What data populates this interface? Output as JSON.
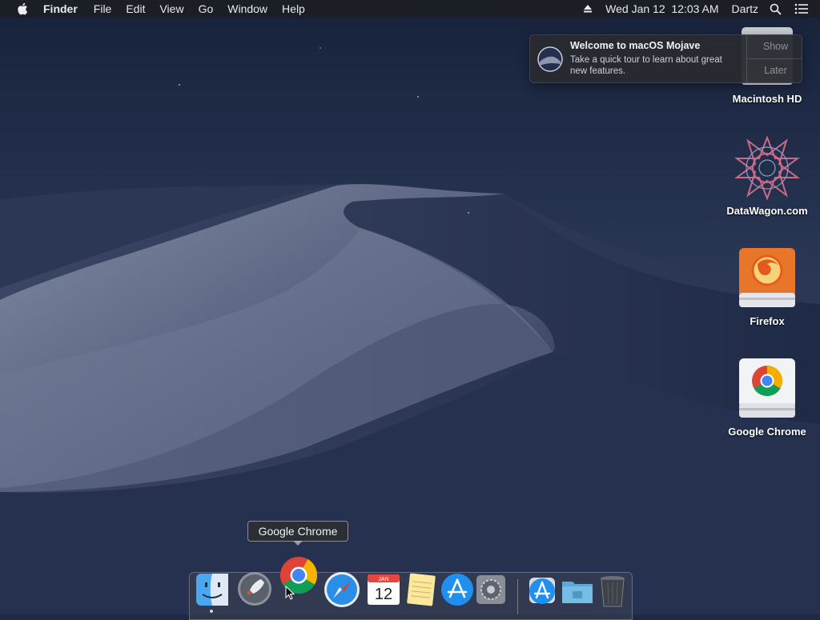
{
  "menubar": {
    "app_name": "Finder",
    "menus": [
      "File",
      "Edit",
      "View",
      "Go",
      "Window",
      "Help"
    ],
    "datetime": "Wed Jan 12  12:03 AM",
    "user": "Dartz",
    "icons": [
      "apple-icon",
      "eject-icon",
      "spotlight-search-icon",
      "notification-center-icon"
    ]
  },
  "notification": {
    "title": "Welcome to macOS Mojave",
    "body": "Take a quick tour to learn about great new features.",
    "show_label": "Show",
    "later_label": "Later"
  },
  "desktop": {
    "icons": [
      {
        "label": "Macintosh HD",
        "icon": "hard-drive-icon"
      },
      {
        "label": "DataWagon.com",
        "icon": "datawagon-icon"
      },
      {
        "label": "Firefox",
        "icon": "firefox-drive-icon"
      },
      {
        "label": "Google Chrome",
        "icon": "chrome-drive-icon"
      }
    ]
  },
  "tooltip": {
    "text": "Google Chrome"
  },
  "dock": {
    "calendar_month": "JAN",
    "calendar_day": "12",
    "items": [
      "Finder",
      "Launchpad",
      "Google Chrome",
      "Safari",
      "Calendar",
      "Notes",
      "App Store",
      "System Preferences",
      "Downloads",
      "Documents",
      "Trash"
    ]
  }
}
